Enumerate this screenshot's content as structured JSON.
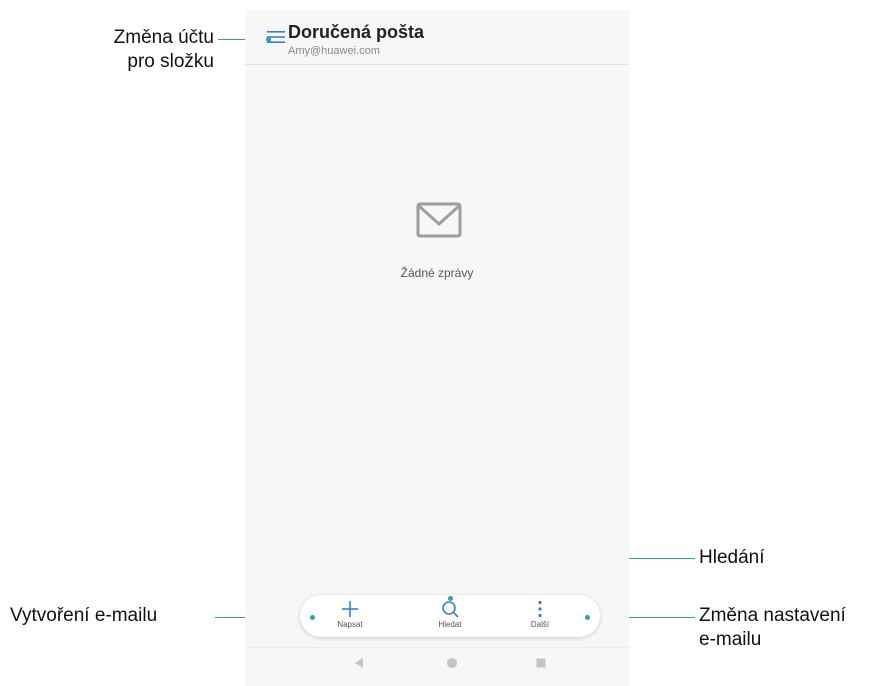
{
  "app": {
    "title": "Doručená pošta",
    "account": "Amy@huawei.com"
  },
  "empty_state": {
    "icon": "envelope-icon",
    "message": "Žádné zprávy"
  },
  "bottom_bar": {
    "actions": [
      {
        "label": "Napsat",
        "icon": "plus-icon"
      },
      {
        "label": "Hledat",
        "icon": "search-icon"
      },
      {
        "label": "Další",
        "icon": "more-vertical-icon"
      }
    ]
  },
  "callouts": {
    "folder_account": [
      "Změna účtu",
      "pro složku"
    ],
    "search": "Hledání",
    "compose": "Vytvoření e-mailu",
    "settings": [
      "Změna nastavení",
      "e-mailu"
    ]
  },
  "colors": {
    "accent": "#3a7bd5",
    "callout_line": "#2aa3a3",
    "background": "#f7f7f7"
  }
}
